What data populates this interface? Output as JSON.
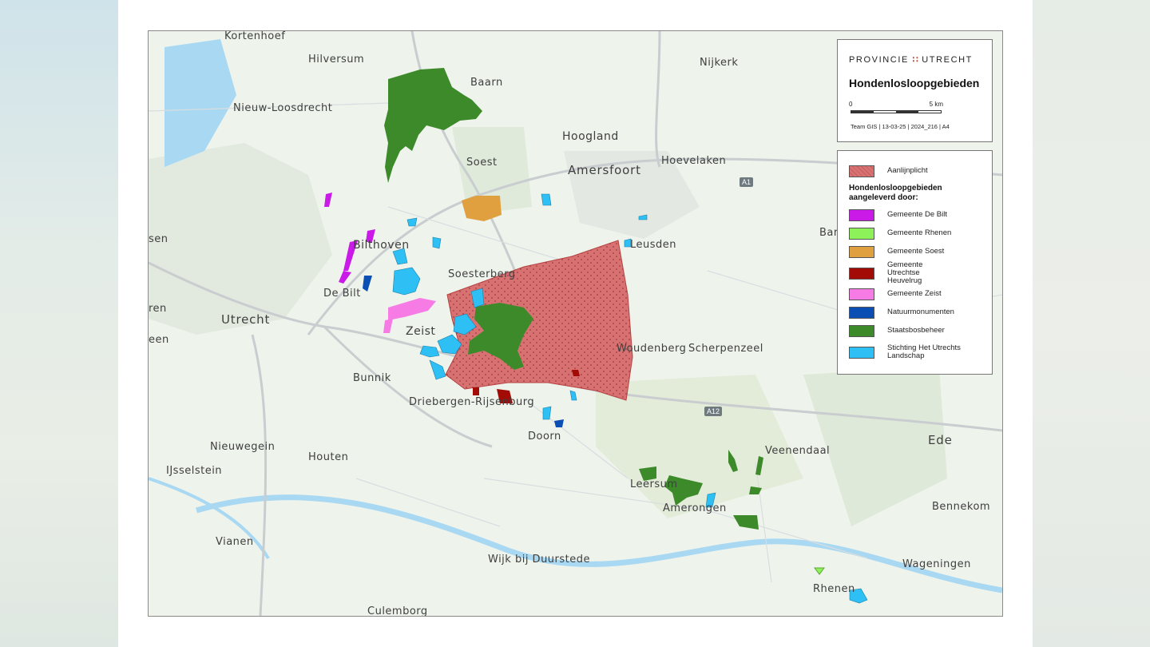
{
  "header": {
    "organisation": "PROVINCIE",
    "organisation_mark": "∷",
    "organisation_name": "UTRECHT",
    "title": "Hondenlosloopgebieden",
    "scale_start": "0",
    "scale_end": "5 km",
    "credit": "Team GIS | 13-03-25 | 2024_216 | A4"
  },
  "legend": {
    "aanlijnplicht": "Aanlijnplicht",
    "heading": "Hondenlosloopgebieden aangeleverd door:",
    "items": [
      {
        "label": "Gemeente De Bilt",
        "color": "#c91ae8"
      },
      {
        "label": "Gemeente Rhenen",
        "color": "#8df25a"
      },
      {
        "label": "Gemeente Soest",
        "color": "#e0a040"
      },
      {
        "label": "Gemeente Utrechtse Heuvelrug",
        "color": "#a30b06"
      },
      {
        "label": "Gemeente Zeist",
        "color": "#f77be5"
      },
      {
        "label": "Natuurmonumenten",
        "color": "#0b4fb5"
      },
      {
        "label": "Staatsbosbeheer",
        "color": "#3c8a2a"
      },
      {
        "label": "Stichting Het Utrechts Landschap",
        "color": "#2ec0f5"
      }
    ],
    "aanlijnplicht_color": "#d87272"
  },
  "places": [
    {
      "name": "Kortenhoef",
      "size": "small"
    },
    {
      "name": "Hilversum",
      "size": "small"
    },
    {
      "name": "Nieuw-Loosdrecht",
      "size": "small"
    },
    {
      "name": "Baarn",
      "size": "small"
    },
    {
      "name": "Nijkerk",
      "size": "small"
    },
    {
      "name": "Hoogland",
      "size": "mid"
    },
    {
      "name": "Soest",
      "size": "small"
    },
    {
      "name": "Amersfoort",
      "size": "big"
    },
    {
      "name": "Hoevelaken",
      "size": "small"
    },
    {
      "name": "Leusden",
      "size": "small"
    },
    {
      "name": "Bilthoven",
      "size": "mid"
    },
    {
      "name": "Soesterberg",
      "size": "small"
    },
    {
      "name": "De Bilt",
      "size": "small"
    },
    {
      "name": "Utrecht",
      "size": "big"
    },
    {
      "name": "Zeist",
      "size": "mid"
    },
    {
      "name": "Woudenberg",
      "size": "small"
    },
    {
      "name": "Scherpenzeel",
      "size": "small"
    },
    {
      "name": "Bunnik",
      "size": "small"
    },
    {
      "name": "Driebergen-Rijsenburg",
      "size": "small"
    },
    {
      "name": "Doorn",
      "size": "small"
    },
    {
      "name": "Nieuwegein",
      "size": "small"
    },
    {
      "name": "Houten",
      "size": "small"
    },
    {
      "name": "IJsselstein",
      "size": "small"
    },
    {
      "name": "Leersum",
      "size": "small"
    },
    {
      "name": "Amerongen",
      "size": "small"
    },
    {
      "name": "Veenendaal",
      "size": "small"
    },
    {
      "name": "Ede",
      "size": "big"
    },
    {
      "name": "Bennekom",
      "size": "small"
    },
    {
      "name": "Vianen",
      "size": "small"
    },
    {
      "name": "Wijk bij Duurstede",
      "size": "small"
    },
    {
      "name": "Wageningen",
      "size": "small"
    },
    {
      "name": "Rhenen",
      "size": "small"
    },
    {
      "name": "Culemborg",
      "size": "small"
    },
    {
      "name": "Baarn",
      "size": "small"
    },
    {
      "name": "Houten",
      "size": "small"
    },
    {
      "name": "Veenendaal",
      "size": "small"
    }
  ],
  "roads": {
    "a1": "A1",
    "a12": "A12"
  },
  "edge_labels": {
    "sen": "sen",
    "een": "een",
    "ren": "ren",
    "bar": "Bar"
  }
}
